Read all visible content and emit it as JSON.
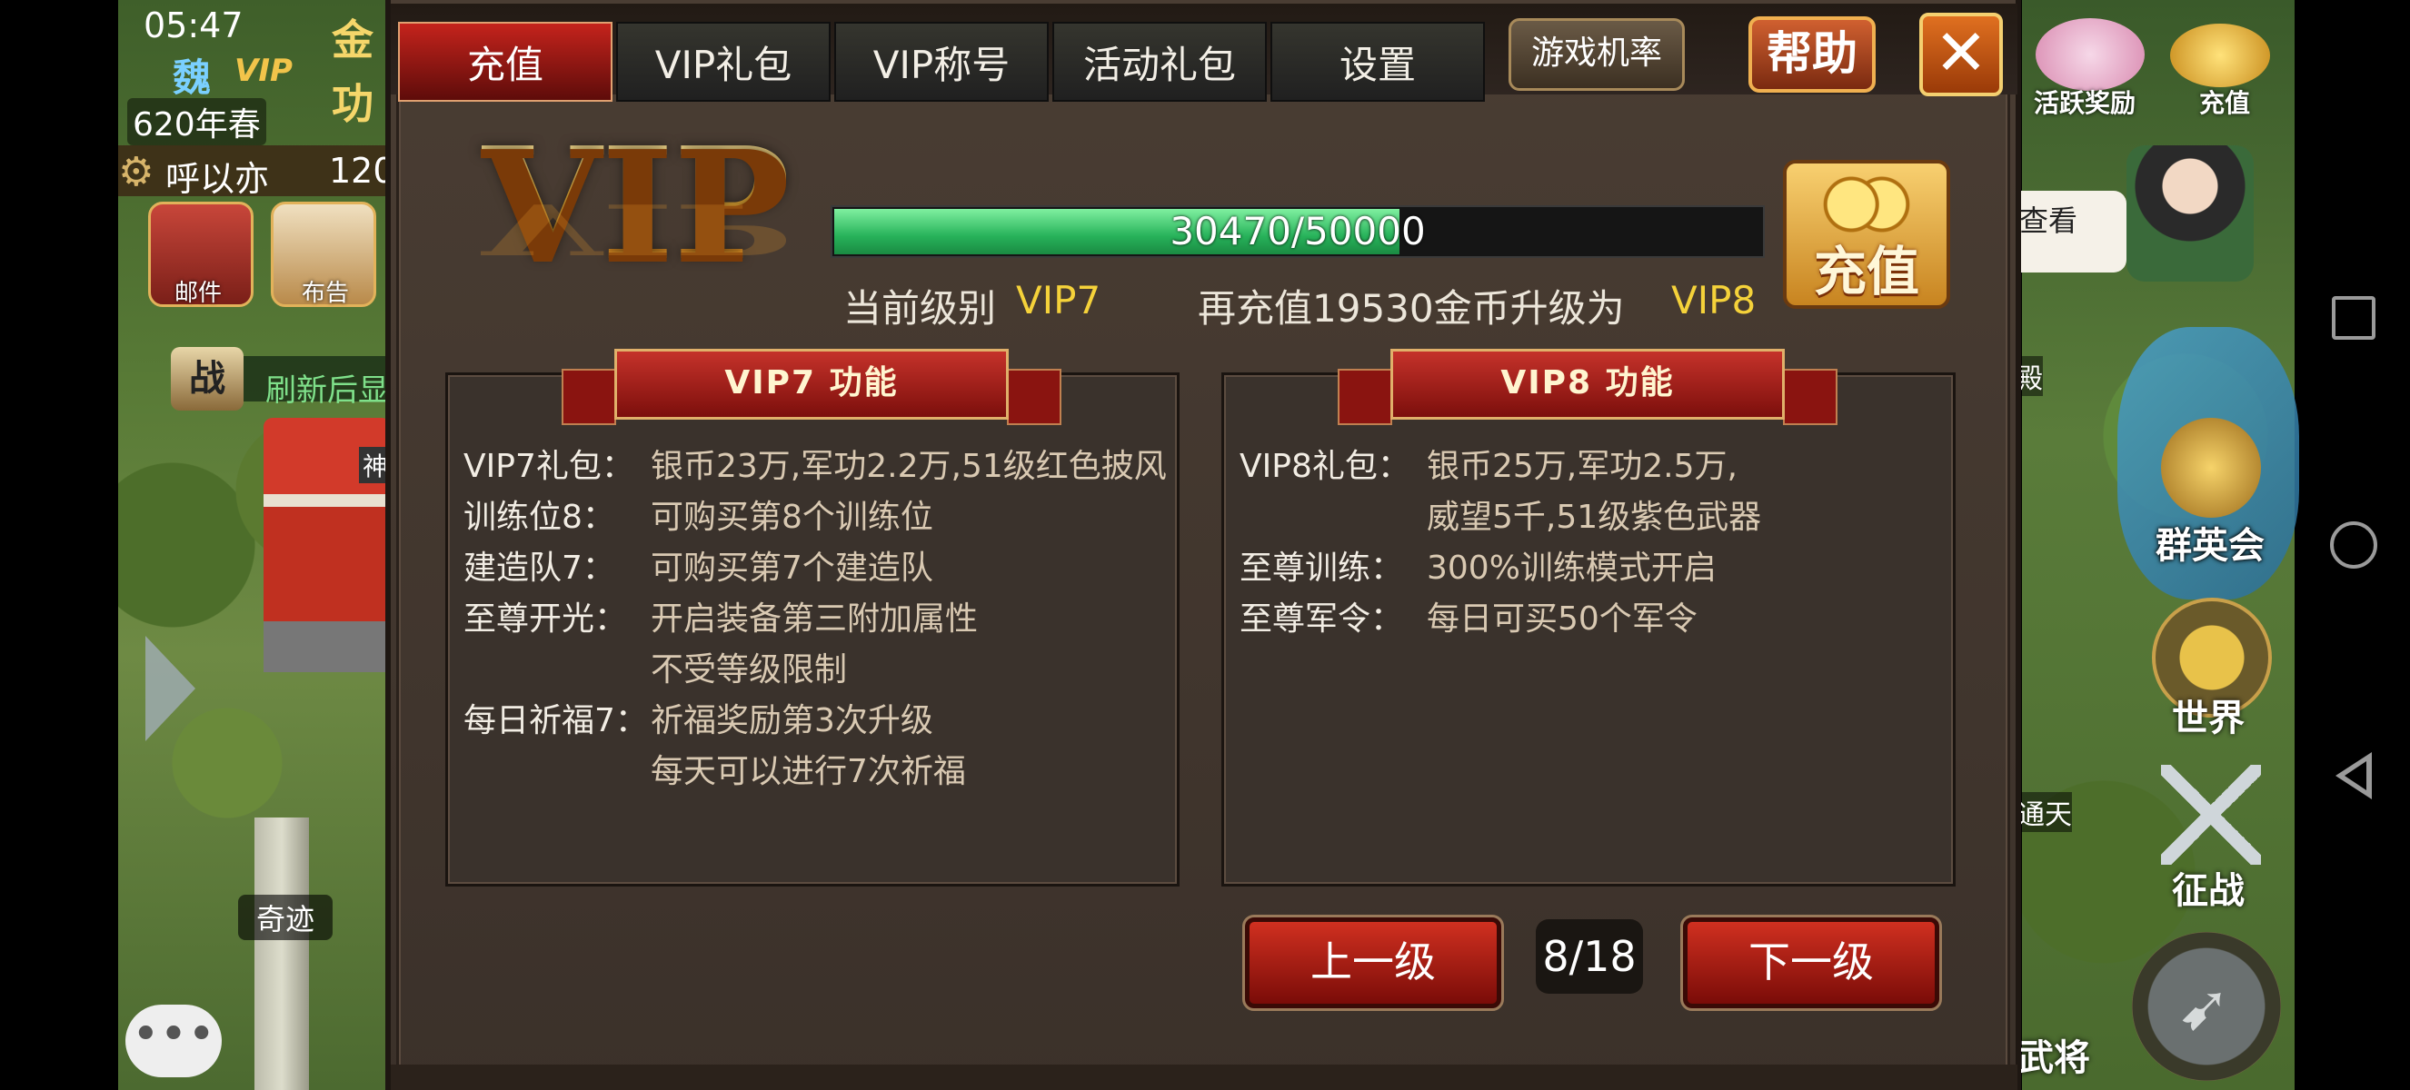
{
  "status": {
    "time": "05:47"
  },
  "player": {
    "kingdom": "魏",
    "vip_badge": "VIP",
    "year": "620年春",
    "name": "呼以亦",
    "count": "120"
  },
  "resources": {
    "gold_label": "金",
    "merit_label": "功"
  },
  "left_hud": {
    "mail_label": "邮件",
    "notice_label": "布告",
    "battle_icon_text": "战",
    "refresh_text": "刷新后显",
    "temple_label": "神",
    "miracle_label": "奇迹",
    "chat_icon": "•••"
  },
  "right_hud": {
    "active_reward_label": "活跃奖励",
    "topup_label": "充值",
    "view_text": "查看",
    "palace_label": "殿",
    "heroes_label": "群英会",
    "world_label": "世界",
    "tongtian_label": "通天",
    "expedition_label": "征战",
    "general_label": "武将",
    "swap_icon": "➹"
  },
  "tabs": [
    {
      "label": "充值",
      "active": true
    },
    {
      "label": "VIP礼包",
      "active": false
    },
    {
      "label": "VIP称号",
      "active": false
    },
    {
      "label": "活动礼包",
      "active": false
    },
    {
      "label": "设置",
      "active": false
    }
  ],
  "header_buttons": {
    "odds": "游戏机率",
    "help": "帮助",
    "close": "✕"
  },
  "vip": {
    "logo": "VIP",
    "progress_current": 30470,
    "progress_max": 50000,
    "progress_fraction": 0.6094,
    "progress_text": "30470/50000",
    "current_level_label": "当前级别",
    "current_level_value": "VIP7",
    "upgrade_prefix": "再充值19530金币升级为",
    "upgrade_target": "VIP8",
    "recharge_button": "充值"
  },
  "panels": {
    "left": {
      "title": "VIP7 功能",
      "rows": [
        {
          "label": "VIP7礼包：",
          "lines": [
            "银币23万,军功2.2万,51级红色披风"
          ]
        },
        {
          "label": "训练位8：",
          "lines": [
            "可购买第8个训练位"
          ]
        },
        {
          "label": "建造队7：",
          "lines": [
            "可购买第7个建造队"
          ]
        },
        {
          "label": "至尊开光：",
          "lines": [
            "开启装备第三附加属性",
            "不受等级限制"
          ]
        },
        {
          "label": "每日祈福7：",
          "lines": [
            "祈福奖励第3次升级",
            "每天可以进行7次祈福"
          ]
        }
      ]
    },
    "right": {
      "title": "VIP8 功能",
      "rows": [
        {
          "label": "VIP8礼包：",
          "lines": [
            "银币25万,军功2.5万,",
            "威望5千,51级紫色武器"
          ]
        },
        {
          "label": "至尊训练：",
          "lines": [
            "300%训练模式开启"
          ]
        },
        {
          "label": "至尊军令：",
          "lines": [
            "每日可买50个军令"
          ]
        }
      ]
    }
  },
  "pager": {
    "prev": "上一级",
    "next": "下一级",
    "indicator": "8/18"
  },
  "colors": {
    "accent_red": "#c4231c",
    "highlight_yellow": "#f5d23a",
    "progress_green": "#27b25a"
  }
}
